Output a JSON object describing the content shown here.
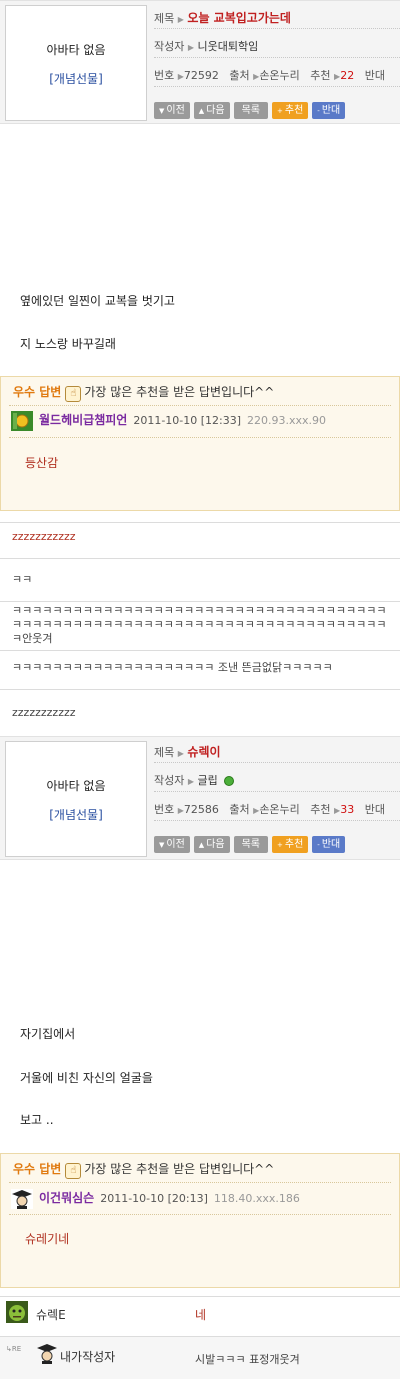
{
  "post1": {
    "avatar_none": "아바타 없음",
    "avatar_gift": "[개념선물]",
    "title_label": "제목",
    "title": "오늘 교복입고가는데",
    "author_label": "작성자",
    "author": "니웃대퇴학임",
    "num_label": "번호",
    "num": "72592",
    "source_label": "출처",
    "source": "손온누리",
    "rec_label": "추천",
    "rec": "22",
    "opp_label": "반대",
    "body": [
      "옆에있던 일찐이 교복을 벗기고",
      "지 노스랑 바꾸길래"
    ]
  },
  "buttons": {
    "prev": "이전",
    "next": "다음",
    "list": "목록",
    "recommend": "추천",
    "oppose": "반대"
  },
  "best_label": "우수 답변",
  "best_desc": "가장 많은 추천을 받은 답변입니다^^",
  "best1": {
    "nick": "월드헤비급챔피언",
    "date": "2011-10-10 [12:33]",
    "ip": "220.93.xxx.90",
    "reply": "등산감"
  },
  "comments": [
    "zzzzzzzzzzz",
    "ㅋㅋ",
    "ㅋㅋㅋㅋㅋㅋㅋㅋㅋㅋㅋㅋㅋㅋㅋㅋㅋㅋㅋㅋㅋㅋㅋㅋㅋㅋㅋㅋㅋㅋㅋㅋㅋㅋㅋㅋㅋㅋㅋㅋㅋㅋㅋㅋㅋㅋㅋㅋㅋㅋㅋㅋㅋㅋㅋㅋㅋㅋㅋㅋㅋㅋㅋㅋㅋㅋㅋㅋㅋㅋㅋㅋㅋㅋㅋ안웃겨",
    "ㅋㅋㅋㅋㅋㅋㅋㅋㅋㅋㅋㅋㅋㅋㅋㅋㅋㅋㅋㅋ 조낸 뜬금없닭ㅋㅋㅋㅋㅋ",
    "zzzzzzzzzzz"
  ],
  "post2": {
    "avatar_none": "아바타 없음",
    "avatar_gift": "[개념선물]",
    "title_label": "제목",
    "title": "슈렉이",
    "author_label": "작성자",
    "author": "글립",
    "num_label": "번호",
    "num": "72586",
    "source_label": "출처",
    "source": "손온누리",
    "rec_label": "추천",
    "rec": "33",
    "opp_label": "반대",
    "body": [
      "자기집에서",
      "거울에 비친 자신의 얼굴을",
      "보고 .."
    ]
  },
  "best2": {
    "nick": "이건뭐심슨",
    "date": "2011-10-10 [20:13]",
    "ip": "118.40.xxx.186",
    "reply": "슈레기네"
  },
  "bottom": {
    "user1": "슈렉E",
    "text1": "네",
    "re": "RE",
    "user2": "내가작성자",
    "text2": "시발ㅋㅋㅋ 표정개웃겨"
  },
  "colors": {
    "title_red": "#c02020",
    "best_orange": "#e07a10",
    "nick_purple": "#7a2aa0",
    "btn_recommend": "#f0a020",
    "btn_oppose": "#5a7ac8"
  }
}
